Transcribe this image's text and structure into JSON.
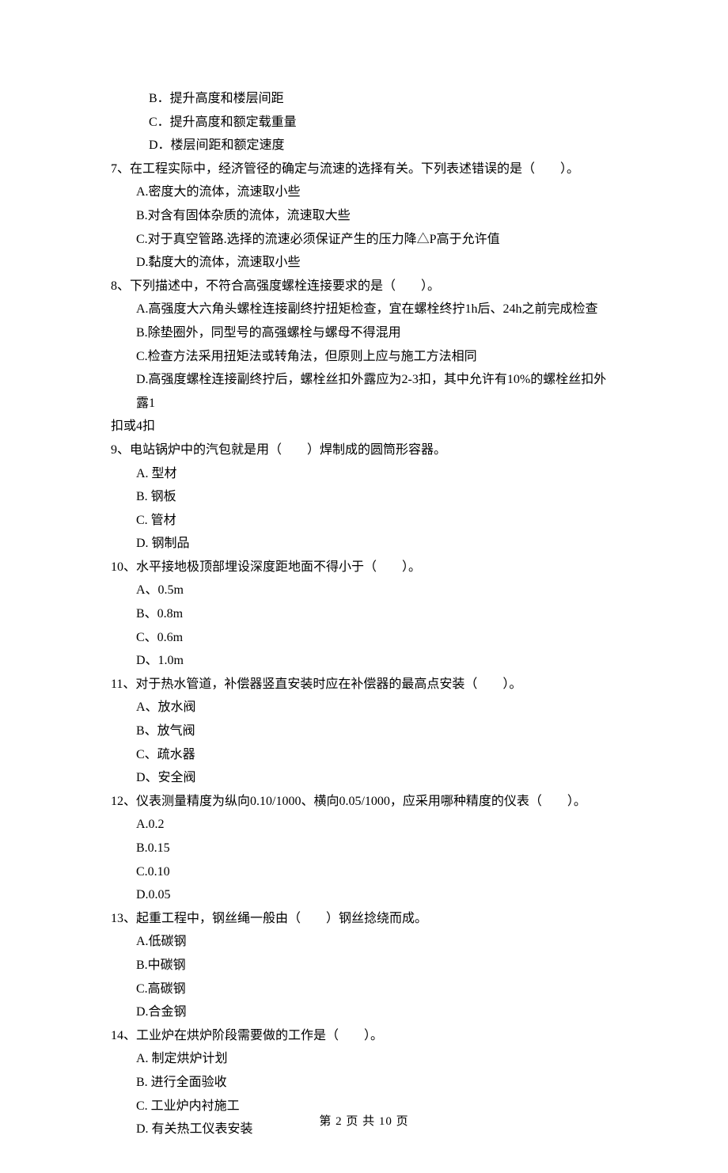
{
  "q6": {
    "options": {
      "B": "B．提升高度和楼层间距",
      "C": "C．提升高度和额定载重量",
      "D": "D．楼层间距和额定速度"
    }
  },
  "q7": {
    "stem": "7、在工程实际中，经济管径的确定与流速的选择有关。下列表述错误的是（　　）。",
    "options": {
      "A": "A.密度大的流体，流速取小些",
      "B": "B.对含有固体杂质的流体，流速取大些",
      "C": "C.对于真空管路.选择的流速必须保证产生的压力降△P高于允许值",
      "D": "D.黏度大的流体，流速取小些"
    }
  },
  "q8": {
    "stem": "8、下列描述中，不符合高强度螺栓连接要求的是（　　）。",
    "options": {
      "A": "A.高强度大六角头螺栓连接副终拧扭矩检查，宜在螺栓终拧1h后、24h之前完成检查",
      "B": "B.除垫圈外，同型号的高强螺栓与螺母不得混用",
      "C": "C.检查方法采用扭矩法或转角法，但原则上应与施工方法相同",
      "D1": "D.高强度螺栓连接副终拧后，螺栓丝扣外露应为2-3扣，其中允许有10%的螺栓丝扣外露1",
      "D2": "扣或4扣"
    }
  },
  "q9": {
    "stem": "9、电站锅炉中的汽包就是用（　　）焊制成的圆筒形容器。",
    "options": {
      "A": "A. 型材",
      "B": "B. 钢板",
      "C": "C. 管材",
      "D": "D. 钢制品"
    }
  },
  "q10": {
    "stem": "10、水平接地极顶部埋设深度距地面不得小于（　　）。",
    "options": {
      "A": "A、0.5m",
      "B": "B、0.8m",
      "C": "C、0.6m",
      "D": "D、1.0m"
    }
  },
  "q11": {
    "stem": "11、对于热水管道，补偿器竖直安装时应在补偿器的最高点安装（　　）。",
    "options": {
      "A": "A、放水阀",
      "B": "B、放气阀",
      "C": "C、疏水器",
      "D": "D、安全阀"
    }
  },
  "q12": {
    "stem": "12、仪表测量精度为纵向0.10/1000、横向0.05/1000，应采用哪种精度的仪表（　　）。",
    "options": {
      "A": "A.0.2",
      "B": "B.0.15",
      "C": "C.0.10",
      "D": "D.0.05"
    }
  },
  "q13": {
    "stem": "13、起重工程中，钢丝绳一般由（　　）钢丝捻绕而成。",
    "options": {
      "A": "A.低碳钢",
      "B": "B.中碳钢",
      "C": "C.高碳钢",
      "D": "D.合金钢"
    }
  },
  "q14": {
    "stem": "14、工业炉在烘炉阶段需要做的工作是（　　）。",
    "options": {
      "A": "A. 制定烘炉计划",
      "B": "B. 进行全面验收",
      "C": "C. 工业炉内衬施工",
      "D": "D. 有关热工仪表安装"
    }
  },
  "footer": "第 2 页 共 10 页"
}
